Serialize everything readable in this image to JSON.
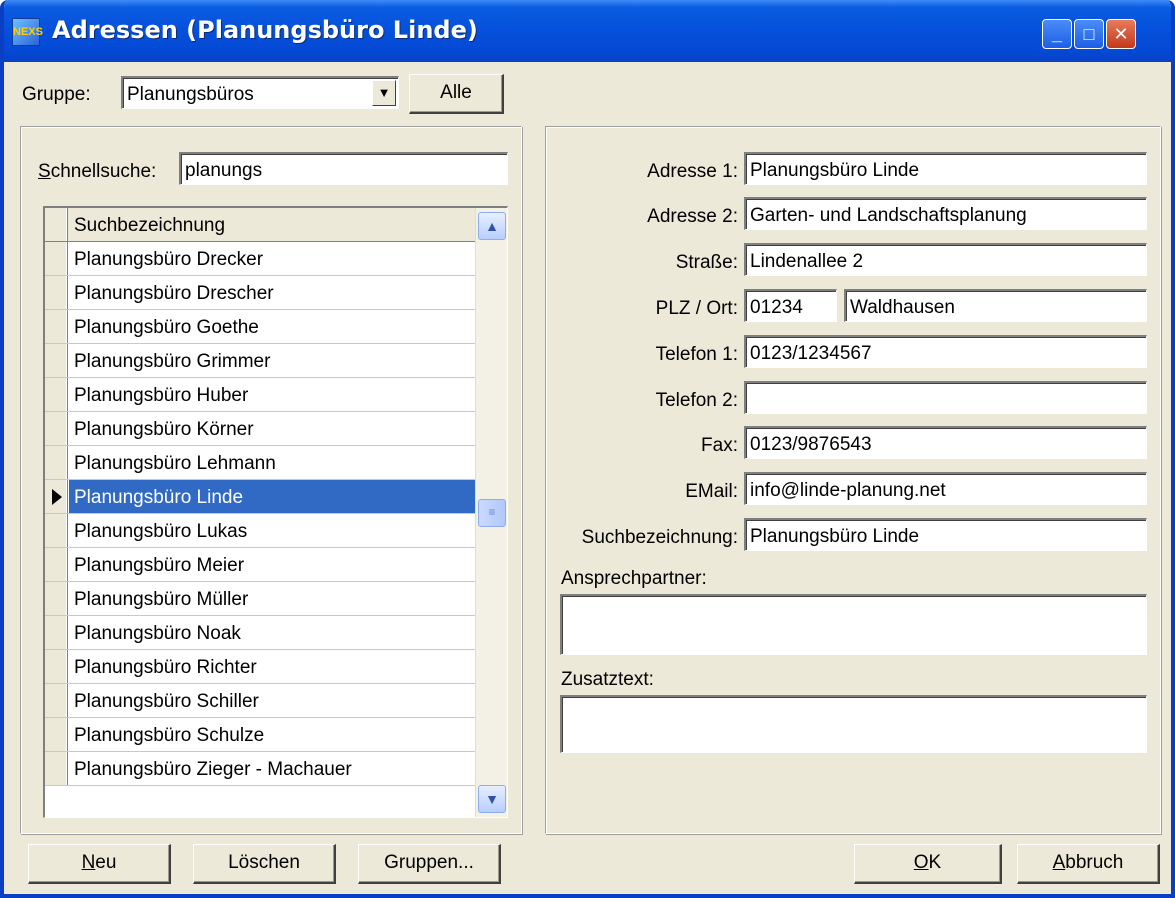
{
  "window": {
    "title": "Adressen (Planungsbüro Linde)",
    "icon_label": "NEXS",
    "controls": {
      "minimize": "_",
      "maximize": "□",
      "close": "✕"
    }
  },
  "top": {
    "group_label": "Gruppe:",
    "group_value": "Planungsbüros",
    "all_button": "Alle"
  },
  "left": {
    "quicksearch_label_first": "S",
    "quicksearch_label_rest": "chnellsuche:",
    "quicksearch_value": "planungs",
    "grid_header": "Suchbezeichnung",
    "rows": [
      "Planungsbüro Drecker",
      "Planungsbüro Drescher",
      "Planungsbüro Goethe",
      "Planungsbüro Grimmer",
      "Planungsbüro Huber",
      "Planungsbüro Körner",
      "Planungsbüro Lehmann",
      "Planungsbüro Linde",
      "Planungsbüro Lukas",
      "Planungsbüro Meier",
      "Planungsbüro Müller",
      "Planungsbüro Noak",
      "Planungsbüro Richter",
      "Planungsbüro Schiller",
      "Planungsbüro Schulze",
      "Planungsbüro Zieger - Machauer"
    ],
    "selected_index": 7
  },
  "right": {
    "labels": {
      "adresse1": "Adresse 1:",
      "adresse2": "Adresse 2:",
      "strasse": "Straße:",
      "plz_ort": "PLZ / Ort:",
      "telefon1": "Telefon 1:",
      "telefon2": "Telefon 2:",
      "fax": "Fax:",
      "email": "EMail:",
      "suchbezeichnung": "Suchbezeichnung:",
      "ansprechpartner": "Ansprechpartner:",
      "zusatztext": "Zusatztext:"
    },
    "values": {
      "adresse1": "Planungsbüro Linde",
      "adresse2": "Garten- und Landschaftsplanung",
      "strasse": "Lindenallee 2",
      "plz": "01234",
      "ort": "Waldhausen",
      "telefon1": "0123/1234567",
      "telefon2": "",
      "fax": "0123/9876543",
      "email": "info@linde-planung.net",
      "suchbezeichnung": "Planungsbüro Linde",
      "ansprechpartner": "",
      "zusatztext": ""
    }
  },
  "buttons": {
    "neu_first": "N",
    "neu_rest": "eu",
    "loeschen": "Löschen",
    "gruppen": "Gruppen...",
    "ok_first": "O",
    "ok_rest": "K",
    "abbruch_first": "A",
    "abbruch_rest": "bbruch"
  }
}
